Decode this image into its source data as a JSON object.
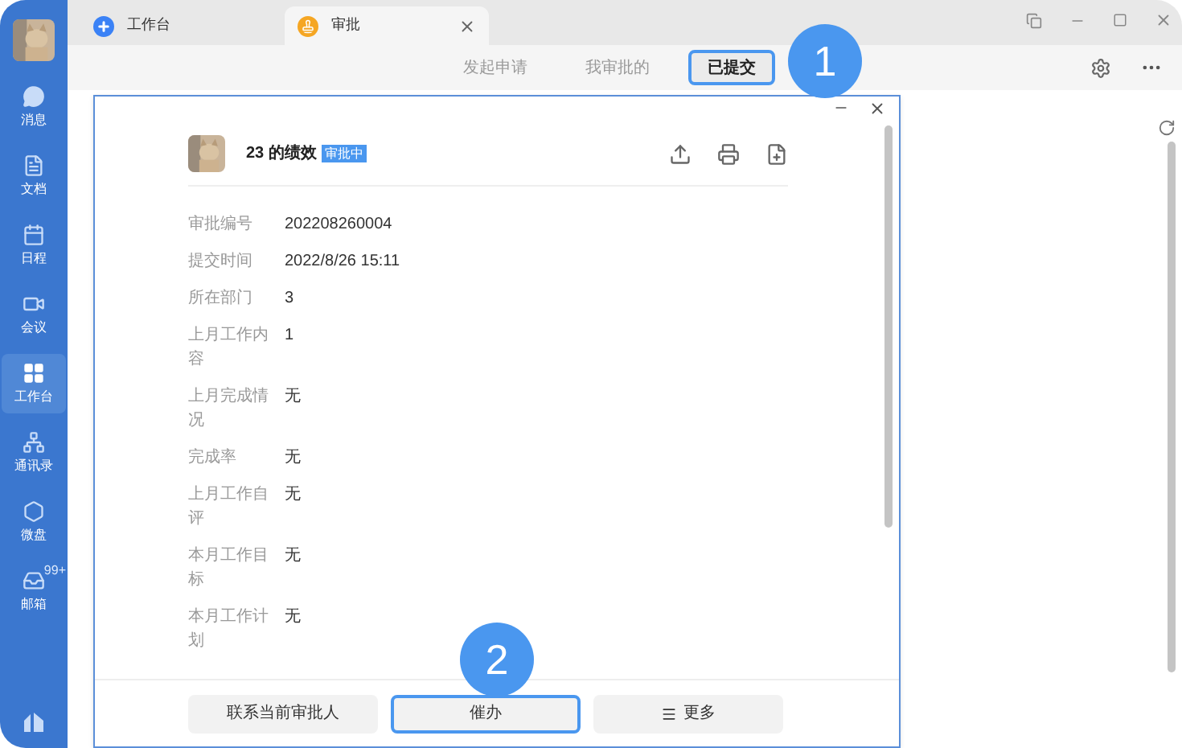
{
  "sidebar": {
    "items": [
      {
        "kind": "chat",
        "label": "消息",
        "selected": false
      },
      {
        "kind": "doc",
        "label": "文档",
        "selected": false
      },
      {
        "kind": "calendar",
        "label": "日程",
        "selected": false
      },
      {
        "kind": "meeting",
        "label": "会议",
        "selected": false
      },
      {
        "kind": "grid",
        "label": "工作台",
        "selected": true
      },
      {
        "kind": "org",
        "label": "通讯录",
        "selected": false
      },
      {
        "kind": "disk",
        "label": "微盘",
        "selected": false
      },
      {
        "kind": "mail",
        "label": "邮箱",
        "selected": false,
        "badge": "99+"
      }
    ]
  },
  "tabs": [
    {
      "kind": "workbench",
      "label": "工作台",
      "selected": false
    },
    {
      "kind": "approval",
      "label": "审批",
      "selected": true
    }
  ],
  "sub_tabs": [
    {
      "label": "发起申请",
      "selected": false,
      "highlighted": false
    },
    {
      "label": "我审批的",
      "selected": false,
      "highlighted": false
    },
    {
      "label": "已提交",
      "selected": true,
      "highlighted": true
    }
  ],
  "callouts": [
    "1",
    "2"
  ],
  "dialog": {
    "title": "23 的绩效",
    "status": "审批中",
    "fields": [
      {
        "label": "审批编号",
        "value": "202208260004"
      },
      {
        "label": "提交时间",
        "value": "2022/8/26 15:11"
      },
      {
        "label": "所在部门",
        "value": "3"
      },
      {
        "label": "上月工作内容",
        "value": "1"
      },
      {
        "label": "上月完成情况",
        "value": "无"
      },
      {
        "label": "完成率",
        "value": "无"
      },
      {
        "label": "上月工作自评",
        "value": "无"
      },
      {
        "label": "本月工作目标",
        "value": "无"
      },
      {
        "label": "本月工作计划",
        "value": "无"
      }
    ],
    "buttons": [
      {
        "label": "联系当前审批人",
        "highlighted": false,
        "icon": false
      },
      {
        "label": "催办",
        "highlighted": true,
        "icon": false
      },
      {
        "label": "更多",
        "highlighted": false,
        "icon": true
      }
    ]
  }
}
